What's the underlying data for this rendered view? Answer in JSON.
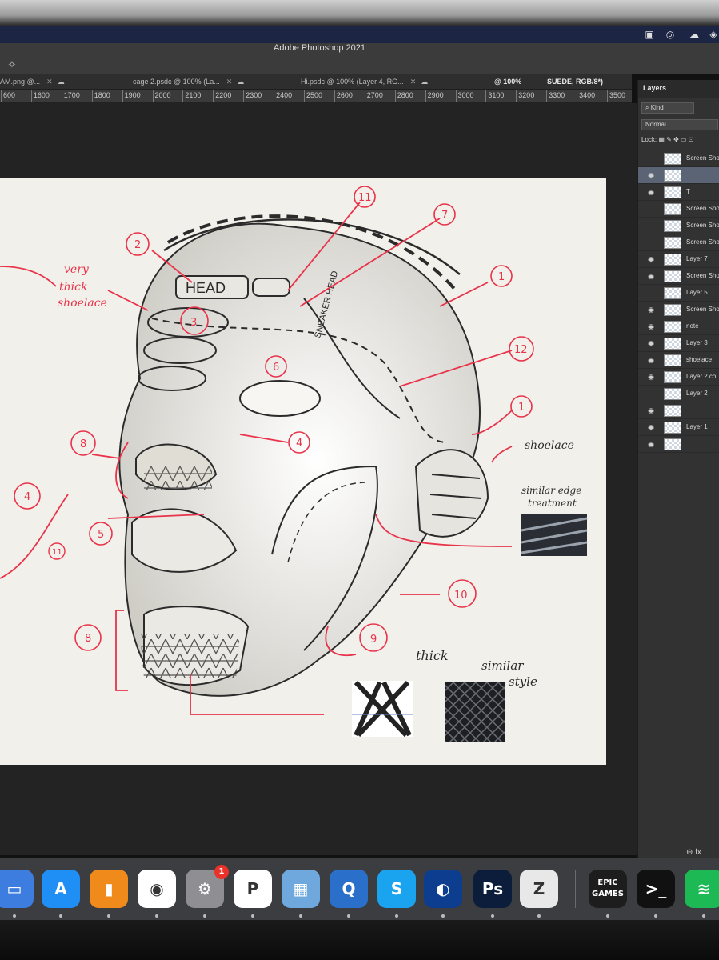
{
  "app": {
    "title": "Adobe Photoshop 2021"
  },
  "tabs": [
    {
      "label": "AM.png @...",
      "close": "✕",
      "cloud": "☁"
    },
    {
      "label": "cage 2.psdc @ 100% (La...",
      "close": "✕",
      "cloud": "☁"
    },
    {
      "label": "Hi.psdc @ 100% (Layer 4, RG...",
      "close": "✕",
      "cloud": "☁"
    }
  ],
  "tab_right": {
    "zoom": "@ 100%",
    "doc": "SUEDE, RGB/8*)",
    "close": "•"
  },
  "ruler": [
    "600",
    "1600",
    "1700",
    "1800",
    "1900",
    "2000",
    "2100",
    "2200",
    "2300",
    "2400",
    "2500",
    "2600",
    "2700",
    "2800",
    "2900",
    "3000",
    "3100",
    "3200",
    "3300",
    "3400",
    "3500"
  ],
  "panel": {
    "tab": "Layers",
    "kind": "Kind",
    "blend": "Normal",
    "lock": "Lock:",
    "layers": [
      {
        "name": "Screen Shot",
        "visible": false,
        "selected": false
      },
      {
        "name": "",
        "visible": true,
        "selected": true
      },
      {
        "name": "T",
        "visible": true,
        "selected": false
      },
      {
        "name": "Screen Sho",
        "visible": false,
        "selected": false
      },
      {
        "name": "Screen Sho",
        "visible": false,
        "selected": false
      },
      {
        "name": "Screen Sho",
        "visible": false,
        "selected": false
      },
      {
        "name": "Layer 7",
        "visible": true,
        "selected": false
      },
      {
        "name": "Screen Sho",
        "visible": true,
        "selected": false
      },
      {
        "name": "Layer 5",
        "visible": false,
        "selected": false
      },
      {
        "name": "Screen Sho",
        "visible": true,
        "selected": false
      },
      {
        "name": "note",
        "visible": true,
        "selected": false
      },
      {
        "name": "Layer 3",
        "visible": true,
        "selected": false
      },
      {
        "name": "shoelace",
        "visible": true,
        "selected": false
      },
      {
        "name": "Layer 2 co",
        "visible": true,
        "selected": false
      },
      {
        "name": "Layer 2",
        "visible": false,
        "selected": false
      },
      {
        "name": "",
        "visible": true,
        "selected": false
      },
      {
        "name": "Layer 1",
        "visible": true,
        "selected": false
      },
      {
        "name": "",
        "visible": true,
        "selected": false
      }
    ],
    "footer": "⊖  fx"
  },
  "canvas": {
    "head_label": "HEAD",
    "sneaker_label": "SNEAKER HEAD",
    "notes": {
      "very_thick_shoelace": [
        "very",
        "thick",
        "shoelace"
      ],
      "shoelace": "shoelace",
      "edge": [
        "similar edge",
        "treatment"
      ],
      "thick": "thick",
      "similar_style": [
        "similar",
        "style"
      ]
    },
    "numbers": [
      "11",
      "7",
      "2",
      "1",
      "3",
      "12",
      "6",
      "1",
      "8",
      "4",
      "4",
      "5",
      "11",
      "10",
      "8",
      "9"
    ]
  },
  "dock": {
    "apps": [
      {
        "name": "keynote",
        "label": "▭",
        "color": "#3d7de0"
      },
      {
        "name": "app-store",
        "label": "A",
        "color": "#1f8ff5"
      },
      {
        "name": "books",
        "label": "▮",
        "color": "#f08a1b"
      },
      {
        "name": "chrome",
        "label": "◉",
        "color": "#ffffff"
      },
      {
        "name": "system-preferences",
        "label": "⚙",
        "color": "#8e8e93"
      },
      {
        "name": "pixelmator",
        "label": "P",
        "color": "#ffffff"
      },
      {
        "name": "preview",
        "label": "▦",
        "color": "#6fa8dc"
      },
      {
        "name": "quicktime",
        "label": "Q",
        "color": "#2a6fc9"
      },
      {
        "name": "skype",
        "label": "S",
        "color": "#1aa3ef"
      },
      {
        "name": "cinema4d",
        "label": "◐",
        "color": "#0c3d8f"
      },
      {
        "name": "photoshop",
        "label": "Ps",
        "color": "#0b1d3a"
      },
      {
        "name": "zbrush",
        "label": "Z",
        "color": "#e8e8e8"
      },
      {
        "name": "epic-games",
        "label": "EPIC GAMES",
        "color": "#1d1d1d"
      },
      {
        "name": "terminal",
        "label": ">_",
        "color": "#111111"
      },
      {
        "name": "spotify",
        "label": "≋",
        "color": "#1db954"
      }
    ],
    "badge": "1"
  }
}
